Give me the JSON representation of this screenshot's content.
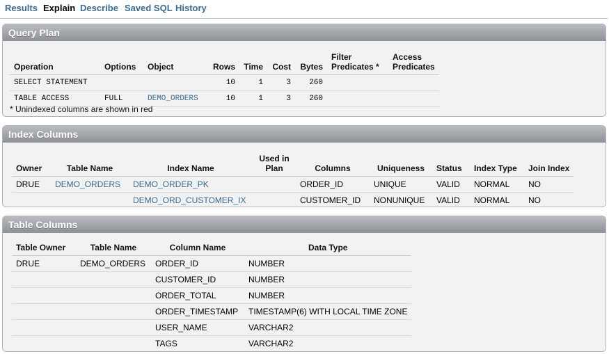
{
  "tabs": [
    {
      "label": "Results"
    },
    {
      "label": "Explain"
    },
    {
      "label": "Describe"
    },
    {
      "label": "Saved SQL"
    },
    {
      "label": "History"
    }
  ],
  "query_plan": {
    "title": "Query Plan",
    "headers": {
      "operation": "Operation",
      "options": "Options",
      "object": "Object",
      "rows": "Rows",
      "time": "Time",
      "cost": "Cost",
      "bytes": "Bytes",
      "filter_1": "Filter",
      "filter_2": "Predicates *",
      "access_1": "Access",
      "access_2": "Predicates"
    },
    "rows": [
      {
        "operation": "SELECT STATEMENT",
        "options": "",
        "object": "",
        "rows": "10",
        "time": "1",
        "cost": "3",
        "bytes": "260"
      },
      {
        "operation": "TABLE ACCESS",
        "options": "FULL",
        "object": "DEMO_ORDERS",
        "rows": "10",
        "time": "1",
        "cost": "3",
        "bytes": "260"
      }
    ],
    "note": "* Unindexed columns are shown in red"
  },
  "index_columns": {
    "title": "Index Columns",
    "headers": {
      "owner": "Owner",
      "table_name": "Table Name",
      "index_name": "Index Name",
      "used_1": "Used in",
      "used_2": "Plan",
      "columns": "Columns",
      "uniqueness": "Uniqueness",
      "status": "Status",
      "index_type": "Index Type",
      "join_index": "Join Index"
    },
    "rows": [
      {
        "owner": "DRUE",
        "table_name": "DEMO_ORDERS",
        "index_name": "DEMO_ORDER_PK",
        "used": "",
        "columns": "ORDER_ID",
        "uniqueness": "UNIQUE",
        "status": "VALID",
        "index_type": "NORMAL",
        "join_index": "NO"
      },
      {
        "owner": "",
        "table_name": "",
        "index_name": "DEMO_ORD_CUSTOMER_IX",
        "used": "",
        "columns": "CUSTOMER_ID",
        "uniqueness": "NONUNIQUE",
        "status": "VALID",
        "index_type": "NORMAL",
        "join_index": "NO"
      }
    ]
  },
  "table_columns": {
    "title": "Table Columns",
    "headers": {
      "table_owner": "Table Owner",
      "table_name": "Table Name",
      "column_name": "Column Name",
      "data_type": "Data Type"
    },
    "rows": [
      {
        "table_owner": "DRUE",
        "table_name": "DEMO_ORDERS",
        "column_name": "ORDER_ID",
        "data_type": "NUMBER"
      },
      {
        "table_owner": "",
        "table_name": "",
        "column_name": "CUSTOMER_ID",
        "data_type": "NUMBER"
      },
      {
        "table_owner": "",
        "table_name": "",
        "column_name": "ORDER_TOTAL",
        "data_type": "NUMBER"
      },
      {
        "table_owner": "",
        "table_name": "",
        "column_name": "ORDER_TIMESTAMP",
        "data_type": "TIMESTAMP(6) WITH LOCAL TIME ZONE"
      },
      {
        "table_owner": "",
        "table_name": "",
        "column_name": "USER_NAME",
        "data_type": "VARCHAR2"
      },
      {
        "table_owner": "",
        "table_name": "",
        "column_name": "TAGS",
        "data_type": "VARCHAR2"
      }
    ]
  }
}
